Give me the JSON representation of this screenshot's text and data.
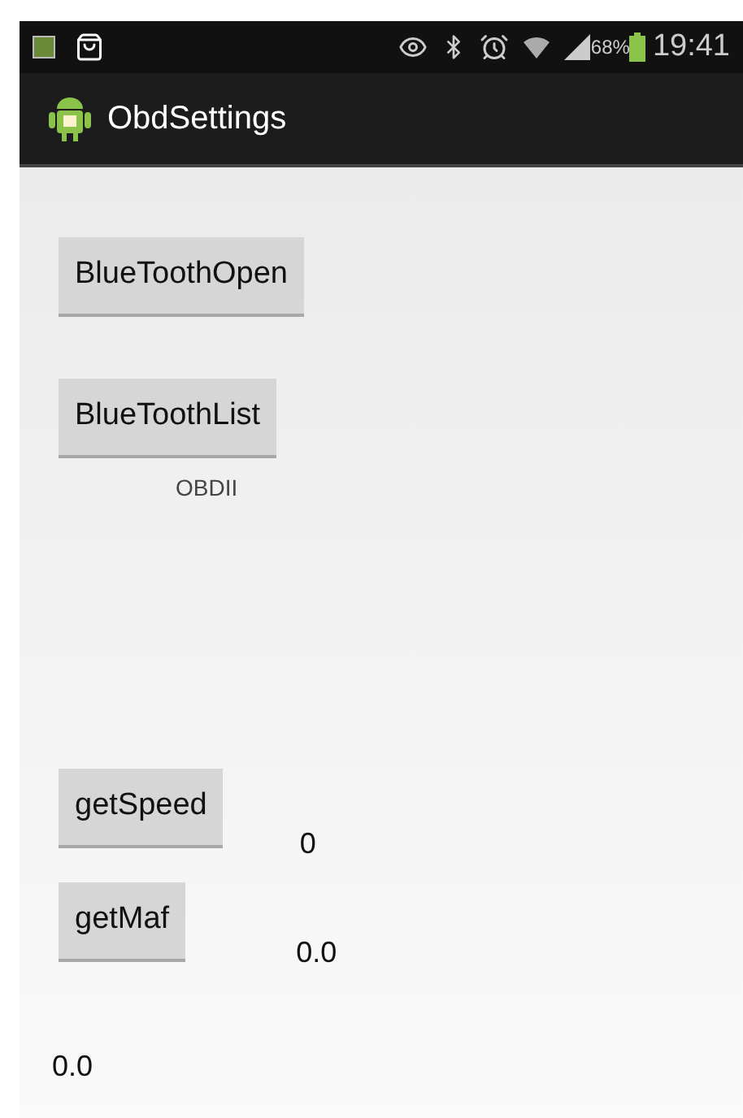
{
  "status_bar": {
    "battery": "68%",
    "time": "19:41"
  },
  "action_bar": {
    "title": "ObdSettings"
  },
  "buttons": [
    {
      "label": "BlueToothOpen"
    },
    {
      "label": "BlueToothList"
    }
  ],
  "device_label": "OBDII",
  "speed": {
    "button": "getSpeed",
    "value": "0"
  },
  "maf": {
    "button": "getMaf",
    "value": "0.0"
  },
  "result": "0.0"
}
